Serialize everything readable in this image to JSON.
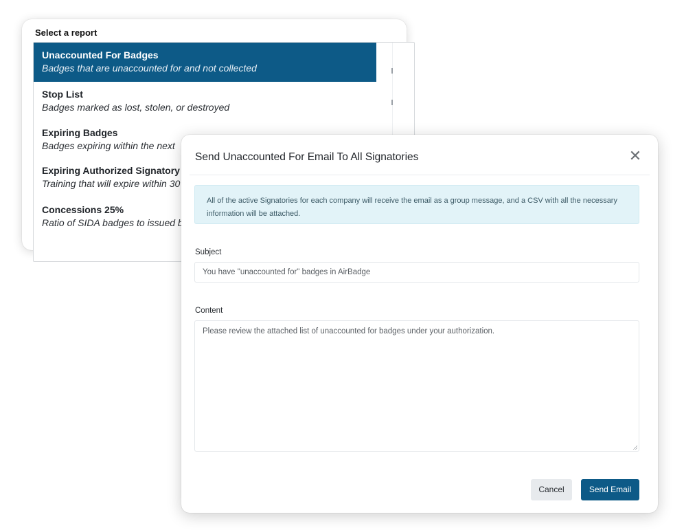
{
  "report_selector": {
    "title": "Select a report",
    "items": [
      {
        "name": "Unaccounted For Badges",
        "description": "Badges that are unaccounted for and not collected",
        "selected": true
      },
      {
        "name": "Stop List",
        "description": "Badges marked as lost, stolen, or destroyed",
        "selected": false
      },
      {
        "name": "Expiring Badges",
        "description": "Badges expiring within the next",
        "selected": false
      },
      {
        "name": "Expiring Authorized Signatory",
        "description": "Training that will expire within 30",
        "selected": false
      },
      {
        "name": "Concessions 25%",
        "description": "Ratio of SIDA badges to issued b",
        "selected": false
      }
    ]
  },
  "modal": {
    "title": "Send Unaccounted For Email To All Signatories",
    "close_icon": "close-icon",
    "info_text": "All of the active Signatories for each company will receive the email as a group message, and a CSV with all the necessary information will be attached.",
    "subject_label": "Subject",
    "subject_value": "You have \"unaccounted for\" badges in AirBadge",
    "content_label": "Content",
    "content_value": "Please review the attached list of unaccounted for badges under your authorization.",
    "cancel_label": "Cancel",
    "send_label": "Send Email"
  },
  "colors": {
    "accent": "#0d5a87",
    "info_bg": "#e2f3f8",
    "cancel_bg": "#e7eaed"
  }
}
